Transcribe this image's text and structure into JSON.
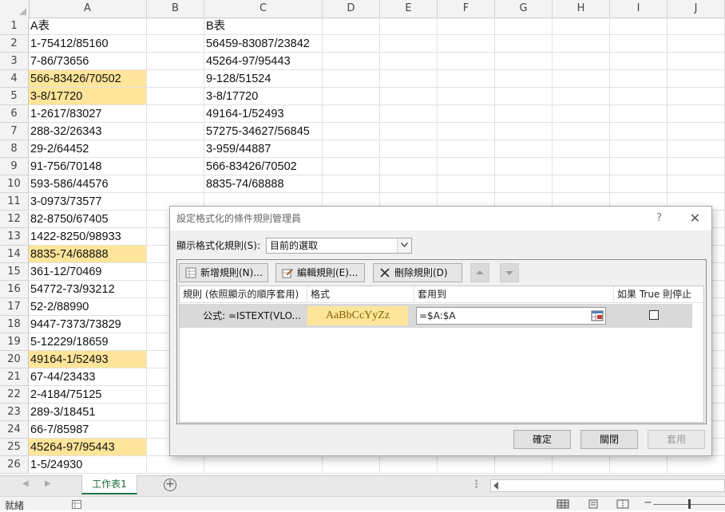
{
  "spreadsheet": {
    "columns": [
      "A",
      "B",
      "C",
      "D",
      "E",
      "F",
      "G",
      "H",
      "I",
      "J"
    ],
    "rows": [
      {
        "num": "1",
        "a": "A表",
        "c": "B表",
        "hl": false
      },
      {
        "num": "2",
        "a": "1-75412/85160",
        "c": "56459-83087/23842",
        "hl": false
      },
      {
        "num": "3",
        "a": "7-86/73656",
        "c": "45264-97/95443",
        "hl": false
      },
      {
        "num": "4",
        "a": "566-83426/70502",
        "c": "9-128/51524",
        "hl": true
      },
      {
        "num": "5",
        "a": "3-8/17720",
        "c": "3-8/17720",
        "hl": true
      },
      {
        "num": "6",
        "a": "1-2617/83027",
        "c": "49164-1/52493",
        "hl": false
      },
      {
        "num": "7",
        "a": "288-32/26343",
        "c": "57275-34627/56845",
        "hl": false
      },
      {
        "num": "8",
        "a": "29-2/64452",
        "c": "3-959/44887",
        "hl": false
      },
      {
        "num": "9",
        "a": "91-756/70148",
        "c": "566-83426/70502",
        "hl": false
      },
      {
        "num": "10",
        "a": "593-586/44576",
        "c": "8835-74/68888",
        "hl": false
      },
      {
        "num": "11",
        "a": "3-0973/73577",
        "c": "",
        "hl": false
      },
      {
        "num": "12",
        "a": "82-8750/67405",
        "c": "",
        "hl": false
      },
      {
        "num": "13",
        "a": "1422-8250/98933",
        "c": "",
        "hl": false
      },
      {
        "num": "14",
        "a": "8835-74/68888",
        "c": "",
        "hl": true
      },
      {
        "num": "15",
        "a": "361-12/70469",
        "c": "",
        "hl": false
      },
      {
        "num": "16",
        "a": "54772-73/93212",
        "c": "",
        "hl": false
      },
      {
        "num": "17",
        "a": "52-2/88990",
        "c": "",
        "hl": false
      },
      {
        "num": "18",
        "a": "9447-7373/73829",
        "c": "",
        "hl": false
      },
      {
        "num": "19",
        "a": "5-12229/18659",
        "c": "",
        "hl": false
      },
      {
        "num": "20",
        "a": "49164-1/52493",
        "c": "",
        "hl": true
      },
      {
        "num": "21",
        "a": "67-44/23433",
        "c": "",
        "hl": false
      },
      {
        "num": "22",
        "a": "2-4184/75125",
        "c": "",
        "hl": false
      },
      {
        "num": "23",
        "a": "289-3/18451",
        "c": "",
        "hl": false
      },
      {
        "num": "24",
        "a": "66-7/85987",
        "c": "",
        "hl": false
      },
      {
        "num": "25",
        "a": "45264-97/95443",
        "c": "",
        "hl": true
      },
      {
        "num": "26",
        "a": "1-5/24930",
        "c": "",
        "hl": false
      }
    ],
    "highlight_color": "#ffe599"
  },
  "dialog": {
    "title": "設定格式化的條件規則管理員",
    "help": "?",
    "close": "✕",
    "show_label": "顯示格式化規則(S):",
    "show_value": "目前的選取",
    "buttons": {
      "new_rule": "新增規則(N)...",
      "edit_rule": "編輯規則(E)...",
      "delete_rule": "刪除規則(D)"
    },
    "table_headers": {
      "rule": "規則 (依照顯示的順序套用)",
      "format": "格式",
      "applies_to": "套用到",
      "stop_if_true": "如果 True 則停止"
    },
    "rule": {
      "name": "公式: =ISTEXT(VLO...",
      "format_preview": "AaBbCcYyZz",
      "applies_to": "=$A:$A"
    },
    "footer": {
      "ok": "確定",
      "close": "關閉",
      "apply": "套用"
    }
  },
  "tabs": {
    "sheet_name": "工作表1",
    "add": "+"
  },
  "status": {
    "text": "就緒",
    "zoom_minus": "−"
  }
}
